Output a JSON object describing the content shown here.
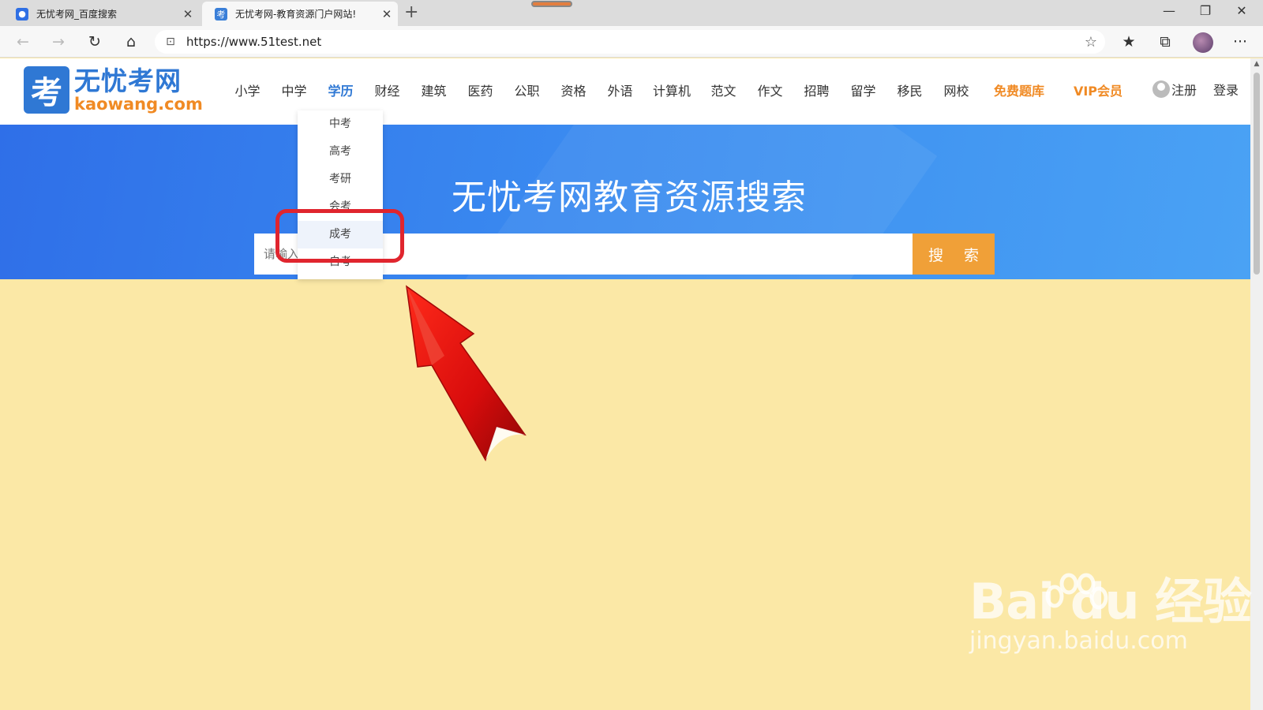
{
  "browser": {
    "tabs": [
      {
        "title": "无忧考网_百度搜索",
        "active": false
      },
      {
        "title": "无忧考网-教育资源门户网站!",
        "active": true
      }
    ],
    "new_tab": "+",
    "close_glyph": "✕",
    "window_controls": {
      "minimize": "—",
      "restore": "❐",
      "close": "✕"
    },
    "url": "https://www.51test.net",
    "icons": [
      "back-icon",
      "forward-icon",
      "refresh-icon",
      "home-icon",
      "lock-icon",
      "star-icon",
      "favorites-icon",
      "collections-icon",
      "profile-avatar",
      "more-icon"
    ],
    "glyphs": {
      "back": "←",
      "forward": "→",
      "refresh": "↻",
      "home": "⌂",
      "lock": "🔒",
      "star": "☆",
      "favorites": "★",
      "collections": "⧉",
      "more": "···"
    }
  },
  "site": {
    "logo": {
      "mark": "考",
      "name": "无忧考网",
      "domain": "kaowang.com"
    },
    "menu": [
      "小学",
      "中学",
      "学历",
      "财经",
      "建筑",
      "医药",
      "公职",
      "资格",
      "外语",
      "计算机",
      "范文",
      "作文",
      "招聘",
      "留学",
      "移民",
      "网校"
    ],
    "menu_active": "学历",
    "menu_highlight": [
      "免费题库",
      "VIP会员"
    ],
    "register": "注册",
    "login": "登录",
    "accent": "#2f78d4",
    "highlight_color": "#f08a24"
  },
  "banner": {
    "title": "无忧考网教育资源搜索",
    "search_placeholder": "请输入",
    "search_button": "搜 索"
  },
  "dropdown": {
    "items": [
      "中考",
      "高考",
      "考研",
      "会考",
      "成考",
      "自考"
    ],
    "hovered": "成考"
  },
  "annotation": {
    "color": "#e0252e",
    "target": "成考"
  },
  "watermark": {
    "brand": "Bai du 经验",
    "url": "jingyan.baidu.com"
  }
}
